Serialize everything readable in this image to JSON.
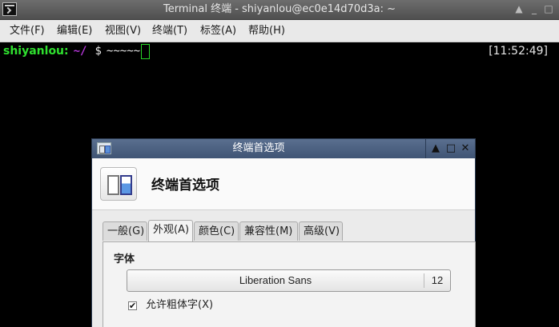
{
  "window": {
    "title": "Terminal 终端 - shiyanlou@ec0e14d70d3a: ~",
    "controls": {
      "restore": "▲",
      "minimize": "_",
      "maximize": "□"
    }
  },
  "menubar": {
    "items": [
      "文件(F)",
      "编辑(E)",
      "视图(V)",
      "终端(T)",
      "标签(A)",
      "帮助(H)"
    ]
  },
  "terminal": {
    "prompt_user": "shiyanlou:",
    "prompt_path": "~/",
    "prompt_symbol": "$",
    "command": "~~~~~",
    "clock": "[11:52:49]",
    "colors": {
      "user": "#2fe02f",
      "path": "#b436d8",
      "text": "#e6e6e6",
      "cursor": "#27d627"
    }
  },
  "prefs_dialog": {
    "title": "终端首选项",
    "header_title": "终端首选项",
    "controls": {
      "restore": "▲",
      "maximize": "□",
      "close": "✕"
    },
    "tabs": [
      {
        "label": "一般(G)",
        "active": false
      },
      {
        "label": "外观(A)",
        "active": true
      },
      {
        "label": "颜色(C)",
        "active": false
      },
      {
        "label": "兼容性(M)",
        "active": false
      },
      {
        "label": "高级(V)",
        "active": false
      }
    ],
    "font_section_label": "字体",
    "font_name": "Liberation Sans",
    "font_size": "12",
    "allow_bold_label": "允许粗体字(X)",
    "allow_bold_checked": true,
    "check_mark": "✔"
  }
}
